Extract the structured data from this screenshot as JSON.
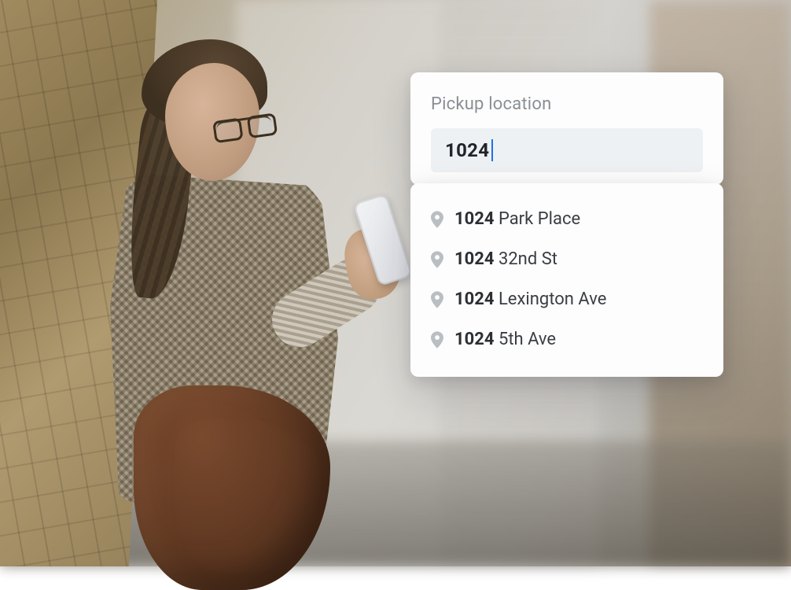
{
  "card": {
    "label": "Pickup location",
    "input_value": "1024"
  },
  "suggestions": [
    {
      "match": "1024",
      "rest": " Park Place"
    },
    {
      "match": "1024",
      "rest": " 32nd St"
    },
    {
      "match": "1024",
      "rest": " Lexington Ave"
    },
    {
      "match": "1024",
      "rest": " 5th Ave"
    }
  ],
  "icons": {
    "pin": "location-pin-icon"
  }
}
